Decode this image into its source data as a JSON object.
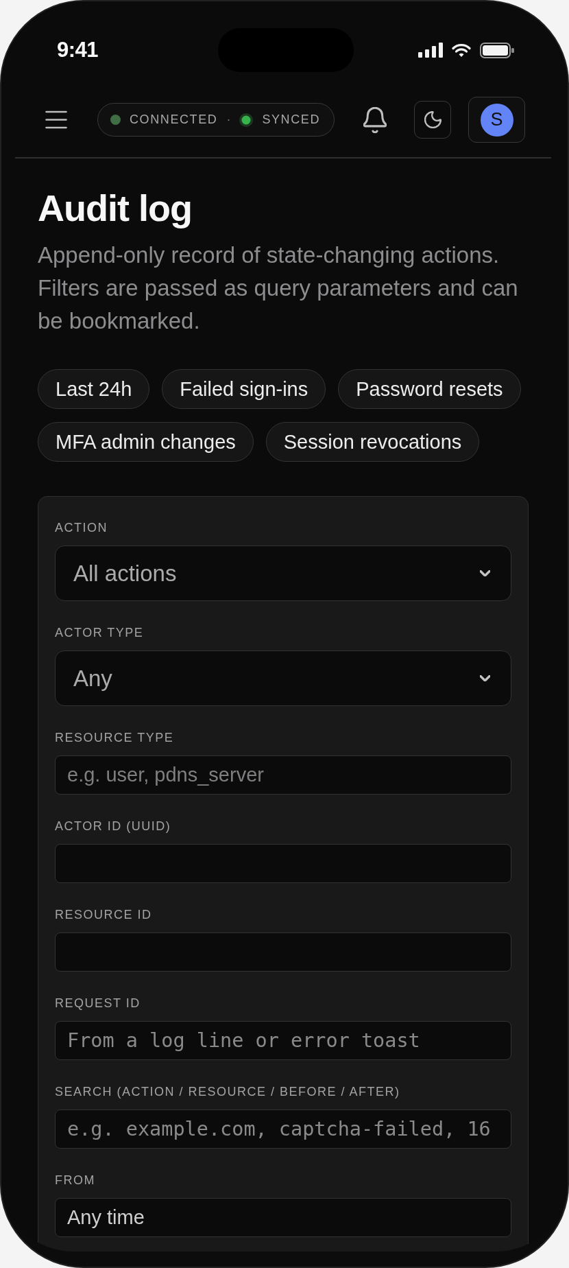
{
  "status_bar": {
    "time": "9:41"
  },
  "header": {
    "statuses": [
      {
        "label": "CONNECTED",
        "color": "#3f6e45",
        "ring": false
      },
      {
        "label": "SYNCED",
        "color": "#37b24d",
        "ring": true
      }
    ],
    "separator": "·",
    "avatar_initial": "S"
  },
  "page": {
    "title": "Audit log",
    "description": "Append-only record of state-changing actions. Filters are passed as query parameters and can be bookmarked."
  },
  "presets": [
    "Last 24h",
    "Failed sign-ins",
    "Password resets",
    "MFA admin changes",
    "Session revocations"
  ],
  "filters": [
    {
      "kind": "select",
      "label": "ACTION",
      "value": "All actions"
    },
    {
      "kind": "select",
      "label": "ACTOR TYPE",
      "value": "Any"
    },
    {
      "kind": "text",
      "label": "RESOURCE TYPE",
      "placeholder": "e.g. user, pdns_server"
    },
    {
      "kind": "text",
      "label": "ACTOR ID (UUID)"
    },
    {
      "kind": "text",
      "label": "RESOURCE ID"
    },
    {
      "kind": "code",
      "label": "REQUEST ID",
      "placeholder": "From a log line or error toast"
    },
    {
      "kind": "code",
      "label": "SEARCH (ACTION / RESOURCE / BEFORE / AFTER)",
      "placeholder": "e.g. example.com, captcha-failed, 16"
    },
    {
      "kind": "text",
      "label": "FROM",
      "value": "Any time"
    }
  ]
}
